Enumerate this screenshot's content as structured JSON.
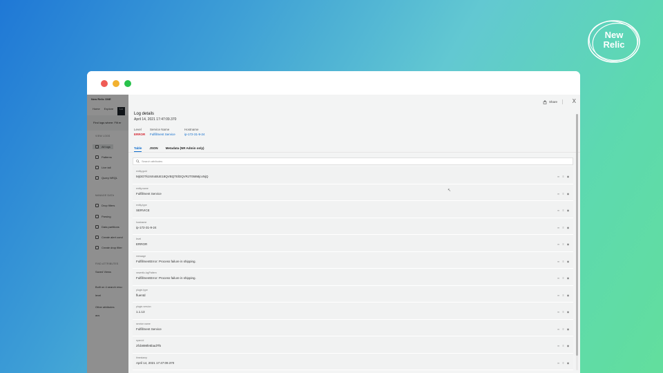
{
  "brand": {
    "logo_line1": "New",
    "logo_line2": "Relic"
  },
  "background_app": {
    "app_name": "New Relic ONE",
    "nav": [
      "Home",
      "Explore",
      "Lo"
    ],
    "query": "Find logs where: Filt er",
    "sections": {
      "view_logs": "VIEW LOGS",
      "manage_data": "MANAGE DATA",
      "find_attributes": "FIND ATTRIBUTES"
    },
    "items": [
      "All logs",
      "Patterns",
      "Live tail",
      "Query NRQL",
      "Drop filters",
      "Parsing",
      "Data partitions",
      "Create alert cond",
      "Create drop filter"
    ],
    "lower": [
      "Saved Views",
      "Built on 4 search resu",
      "level",
      "Other attributes",
      "acs"
    ]
  },
  "panel": {
    "share_label": "Share",
    "close_symbol": "X",
    "title": "Log details",
    "timestamp": "April 14, 2021 17:47:09.370",
    "meta": [
      {
        "label": "Level",
        "value": "ERROR",
        "kind": "error"
      },
      {
        "label": "Service Name",
        "value": "Fulfillment Service",
        "kind": "link"
      },
      {
        "label": "Hostname",
        "value": "ip-172-31-9-24",
        "kind": "link"
      }
    ],
    "tabs": [
      "Table",
      "JSON",
      "Metadata (NR Admin only)"
    ],
    "active_tab": "Table",
    "search_placeholder": "Search attributes"
  },
  "attributes": [
    {
      "key": "entity.guid",
      "value": "MjI3OTk1NXxBUE18QVBQTElDQVRJT058MjcxNjQ"
    },
    {
      "key": "entity.name",
      "value": "Fulfillment Service"
    },
    {
      "key": "entity.type",
      "value": "SERVICE"
    },
    {
      "key": "hostname",
      "value": "ip-172-31-9-24"
    },
    {
      "key": "level",
      "value": "ERROR"
    },
    {
      "key": "message",
      "value": "FulfillmentError: Process failure in shipping."
    },
    {
      "key": "newrelic.logPattern",
      "value": "FulfillmentError: Process failure in shipping."
    },
    {
      "key": "plugin.type",
      "value": "fluentd"
    },
    {
      "key": "plugin.version",
      "value": "1.1.13"
    },
    {
      "key": "service.name",
      "value": "Fulfillment Service"
    },
    {
      "key": "span.id",
      "value": "2fcb898fe5bad7f5"
    },
    {
      "key": "timestamp",
      "value": "April 14, 2021 17:47:09.370"
    }
  ],
  "colors": {
    "accent": "#0b6acb",
    "error": "#d3232f"
  }
}
